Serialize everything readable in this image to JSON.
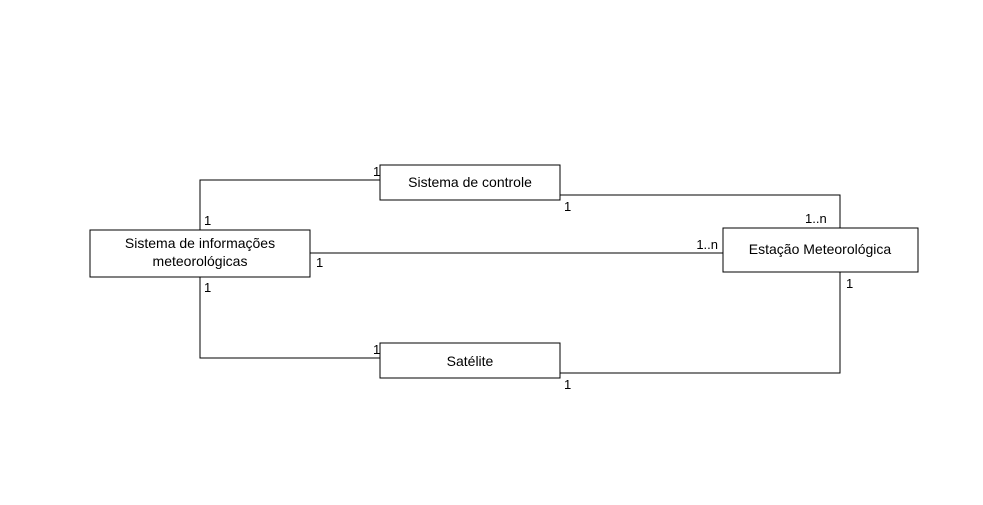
{
  "boxes": {
    "info": "Sistema de informações\nmeteorológicas",
    "control": "Sistema de controle",
    "station": "Estação Meteorológica",
    "satellite": "Satélite"
  },
  "mult": {
    "info_top": "1",
    "info_mid": "1",
    "info_bot": "1",
    "control_left": "1",
    "control_right": "1",
    "satellite_left": "1",
    "satellite_right": "1",
    "station_top": "1..n",
    "station_mid": "1..n",
    "station_bot": "1"
  }
}
